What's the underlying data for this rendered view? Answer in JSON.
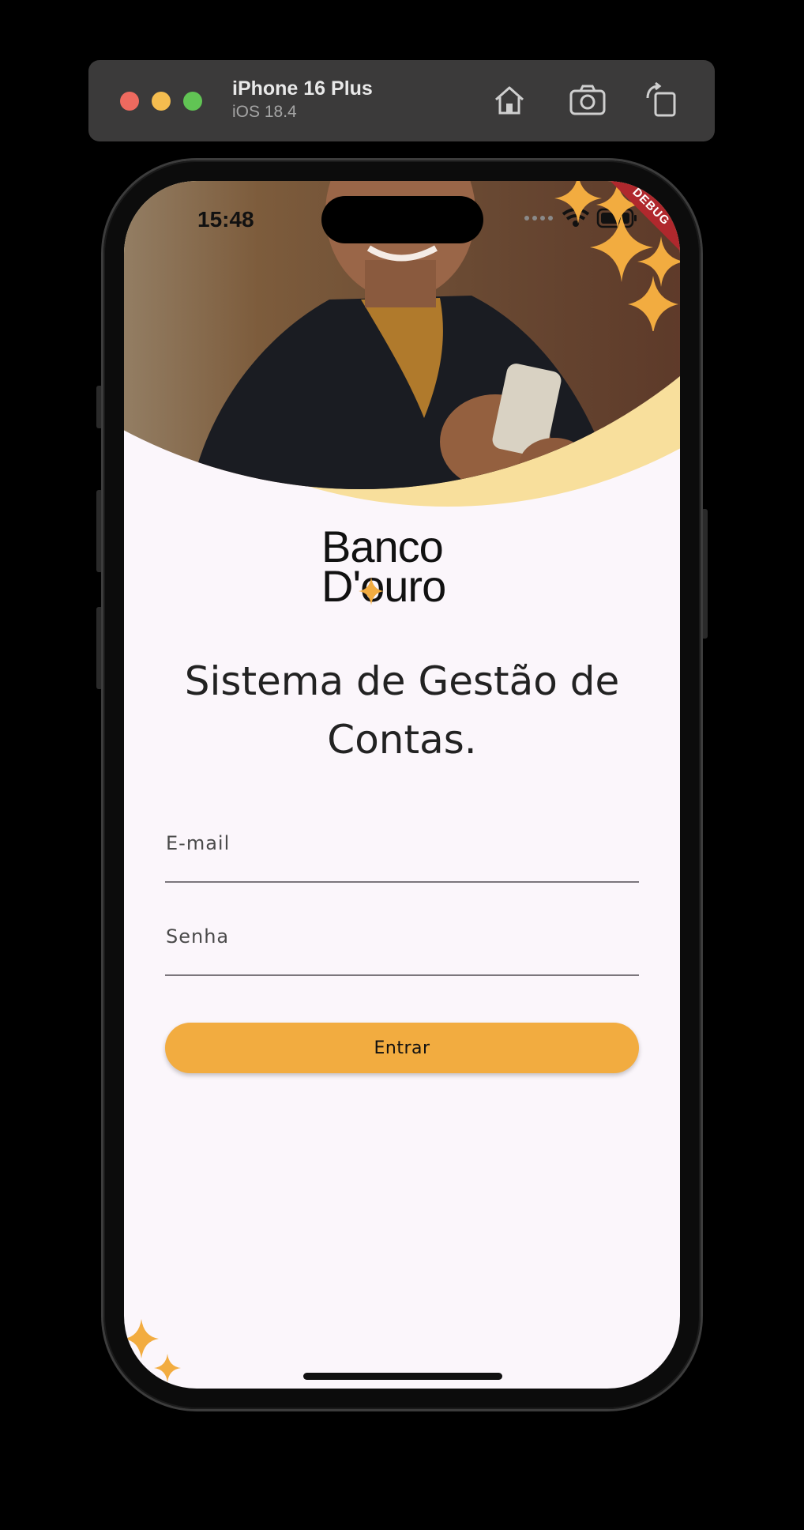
{
  "simulator": {
    "device_name": "iPhone 16 Plus",
    "os_version": "iOS 18.4",
    "tools": [
      "home-icon",
      "screenshot-icon",
      "rotate-icon"
    ]
  },
  "status_bar": {
    "time": "15:48",
    "icons": [
      "signal-dots-icon",
      "wifi-icon",
      "battery-icon"
    ]
  },
  "debug_banner": "DEBUG",
  "logo": {
    "line1": "Banco",
    "line2": "D'ouro"
  },
  "heading": "Sistema de Gestão de Contas.",
  "form": {
    "email_label": "E-mail",
    "password_label": "Senha",
    "submit_label": "Entrar"
  },
  "colors": {
    "accent": "#f2ac40",
    "background": "#fbf6fb",
    "hero_arc": "#f8df9c",
    "debug_ribbon": "#b0282d"
  }
}
